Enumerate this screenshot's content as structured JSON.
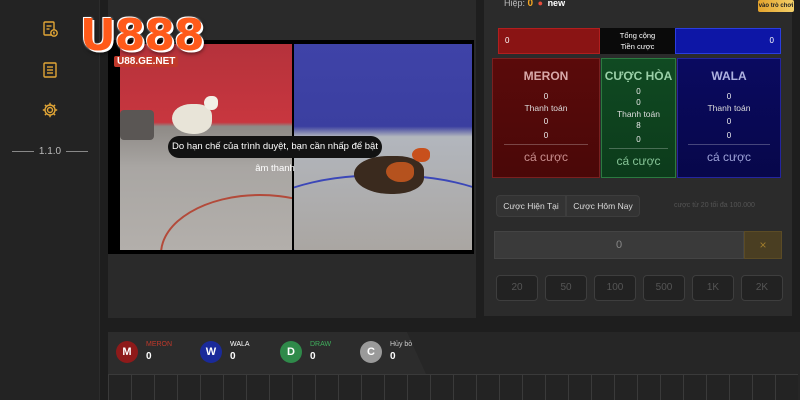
{
  "logo": {
    "text": "U888",
    "url": "U88.GE.NET"
  },
  "sidebar": {
    "version": "1.1.0"
  },
  "video": {
    "notice": "Do hạn chế của trình duyệt, bạn cần nhấp để bật âm thanh"
  },
  "header": {
    "hiep_label": "Hiệp:",
    "hiep_value": "0",
    "new_label": "new",
    "cta_label": "vào trò chơi"
  },
  "totals": {
    "meron": "0",
    "label_line1": "Tổng cộng",
    "label_line2": "Tiền cược",
    "wala": "0"
  },
  "panels": [
    {
      "title": "MERON",
      "top_value": "0",
      "label": "Thanh toán",
      "mid_value": "0",
      "bottom_value": "0",
      "bet_label": "cá cược"
    },
    {
      "title": "CƯỢC HÒA",
      "top_value": "0",
      "top_value2": "0",
      "label": "Thanh toán",
      "mid_value": "8",
      "bottom_value": "0",
      "bet_label": "cá cược"
    },
    {
      "title": "WALA",
      "top_value": "0",
      "label": "Thanh toán",
      "mid_value": "0",
      "bottom_value": "0",
      "bet_label": "cá cược"
    }
  ],
  "tabs": {
    "now": "Cược Hiện Tại",
    "today": "Cược Hôm Nay",
    "note": "cược từ 20 tối đa 100.000"
  },
  "bet_input": {
    "value": "0",
    "clear": "×"
  },
  "chips": [
    "20",
    "50",
    "100",
    "500",
    "1K",
    "2K"
  ],
  "stats": [
    {
      "letter": "M",
      "name": "MERON",
      "count": "0",
      "color": "#8e1a1a",
      "name_color": "#c0392b"
    },
    {
      "letter": "W",
      "name": "WALA",
      "count": "0",
      "color": "#1a2a9a",
      "name_color": "#ffffff"
    },
    {
      "letter": "D",
      "name": "DRAW",
      "count": "0",
      "color": "#2f8a4a",
      "name_color": "#3fae5c"
    },
    {
      "letter": "C",
      "name": "Hủy bỏ",
      "count": "0",
      "color": "#9a9a9a",
      "name_color": "#cccccc"
    }
  ],
  "colors": {
    "accent": "#e2a636",
    "meron": "#8a1414",
    "wala": "#0d16a6",
    "draw": "#104a22"
  }
}
